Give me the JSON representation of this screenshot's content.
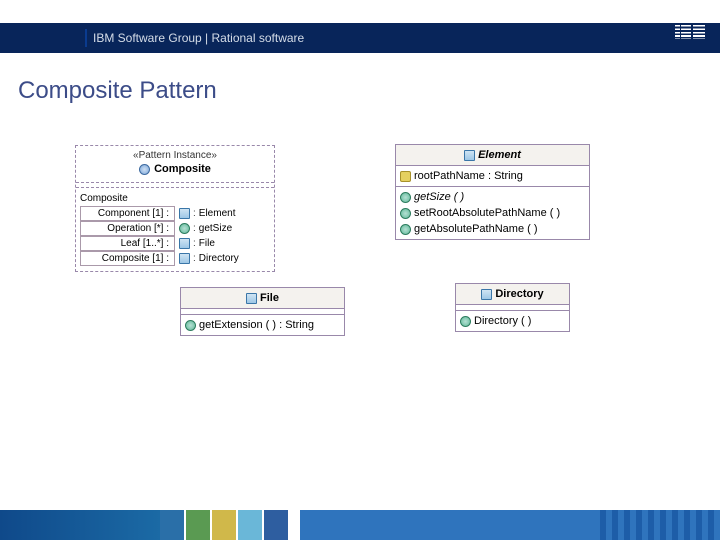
{
  "header": {
    "title_text": "IBM Software Group | Rational software",
    "logo_label": "IBM"
  },
  "slide": {
    "title": "Composite Pattern"
  },
  "pattern_instance": {
    "stereotype": "«Pattern Instance»",
    "name": "Composite",
    "group_label": "Composite",
    "bindings": [
      {
        "role": "Component [1] :",
        "value": "Element"
      },
      {
        "role": "Operation [*] :",
        "value": "getSize"
      },
      {
        "role": "Leaf [1..*] :",
        "value": "File"
      },
      {
        "role": "Composite [1] :",
        "value": "Directory"
      }
    ]
  },
  "classes": {
    "element": {
      "name": "Element",
      "abstract": true,
      "attributes": [
        {
          "text": "rootPathName : String"
        }
      ],
      "operations": [
        {
          "text": "getSize ( )",
          "abstract": true
        },
        {
          "text": "setRootAbsolutePathName ( )"
        },
        {
          "text": "getAbsolutePathName ( )"
        }
      ]
    },
    "file": {
      "name": "File",
      "abstract": false,
      "operations": [
        {
          "text": "getExtension ( ) : String"
        }
      ]
    },
    "directory": {
      "name": "Directory",
      "abstract": false,
      "operations": [
        {
          "text": "Directory ( )"
        }
      ]
    }
  }
}
